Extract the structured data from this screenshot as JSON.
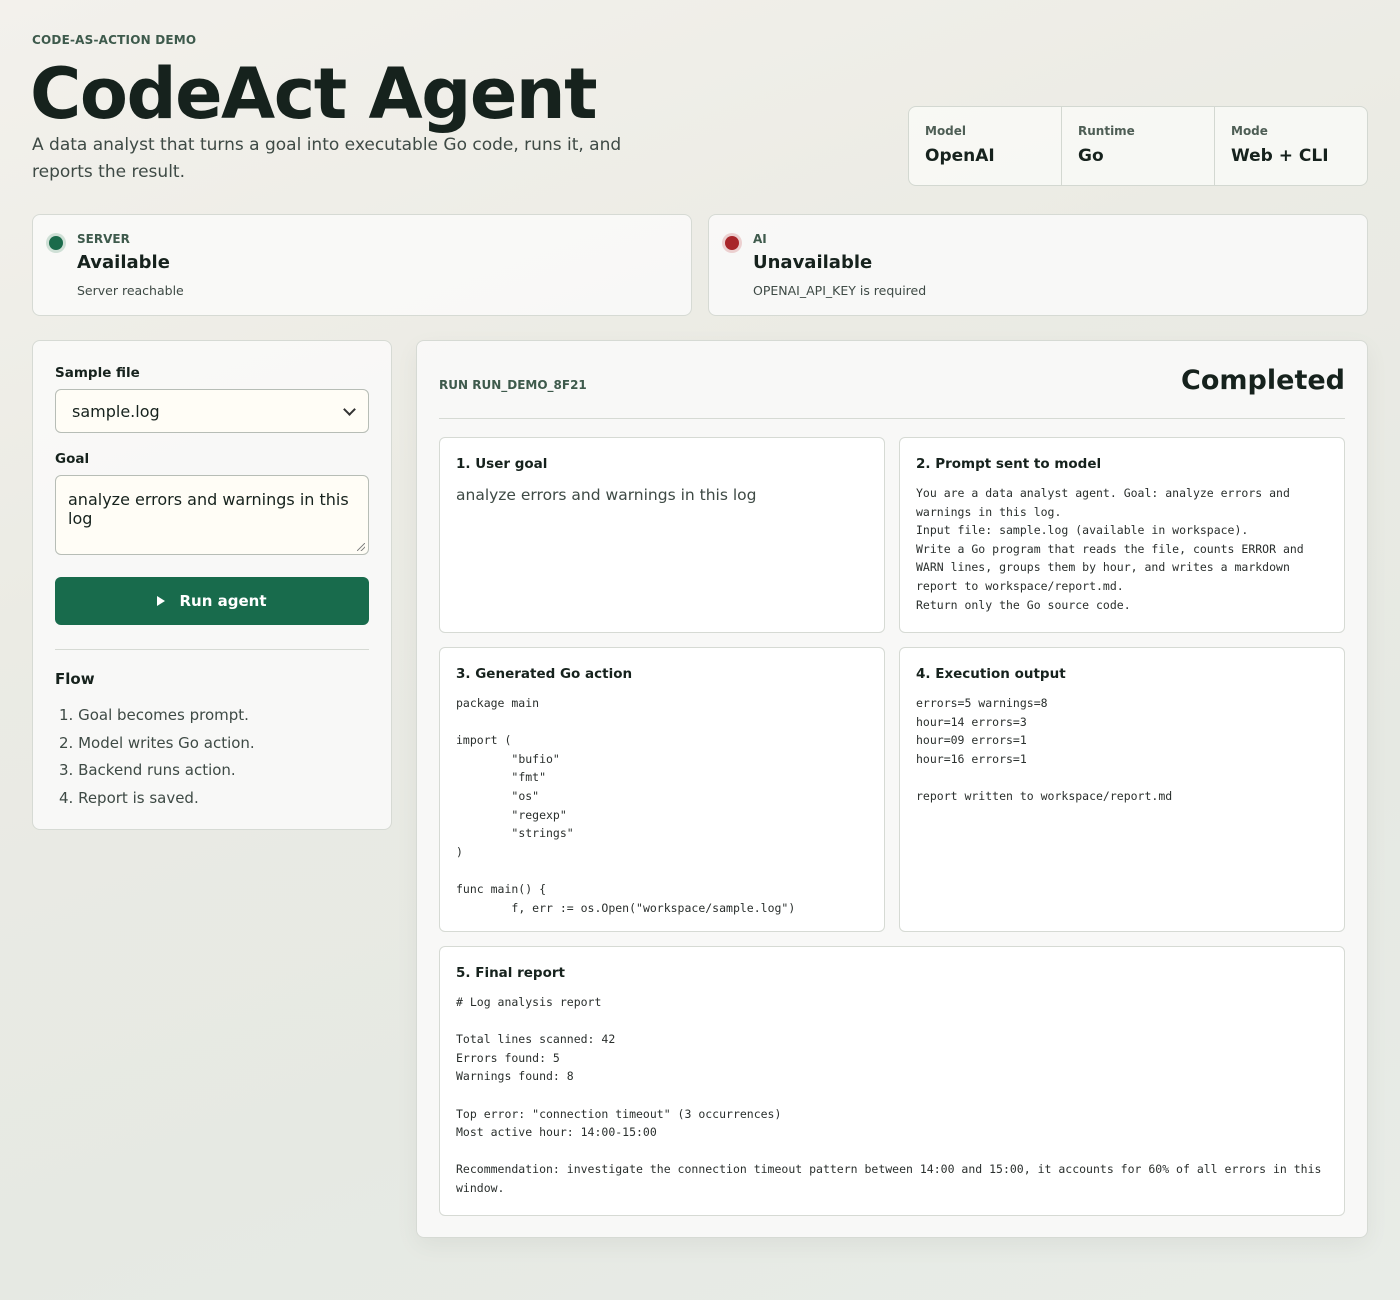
{
  "header": {
    "eyebrow": "CODE-AS-ACTION DEMO",
    "title": "CodeAct Agent",
    "subtitle": "A data analyst that turns a goal into executable Go code, runs it, and reports the result."
  },
  "meta": [
    {
      "label": "Model",
      "value": "OpenAI"
    },
    {
      "label": "Runtime",
      "value": "Go"
    },
    {
      "label": "Mode",
      "value": "Web + CLI"
    }
  ],
  "status": {
    "server": {
      "kind": "SERVER",
      "value": "Available",
      "detail": "Server reachable",
      "color": "#1b6b4b"
    },
    "ai": {
      "kind": "AI",
      "value": "Unavailable",
      "detail": "OPENAI_API_KEY is required",
      "color": "#a8262a"
    }
  },
  "form": {
    "sample_label": "Sample file",
    "sample_value": "sample.log",
    "goal_label": "Goal",
    "goal_value": "analyze errors and warnings in this log",
    "run_label": "Run agent",
    "run_color": "#186b4c"
  },
  "flow": {
    "title": "Flow",
    "steps": [
      "1. Goal becomes prompt.",
      "2. Model writes Go action.",
      "3. Backend runs action.",
      "4. Report is saved."
    ]
  },
  "run": {
    "id": "RUN RUN_DEMO_8F21",
    "state": "Completed",
    "cards": {
      "goal": {
        "title": "1. User goal",
        "body": "analyze errors and warnings in this log"
      },
      "prompt": {
        "title": "2. Prompt sent to model",
        "body": "You are a data analyst agent. Goal: analyze errors and warnings in this log.\nInput file: sample.log (available in workspace).\nWrite a Go program that reads the file, counts ERROR and WARN lines, groups them by hour, and writes a markdown report to workspace/report.md.\nReturn only the Go source code."
      },
      "action": {
        "title": "3. Generated Go action",
        "body": "package main\n\nimport (\n        \"bufio\"\n        \"fmt\"\n        \"os\"\n        \"regexp\"\n        \"strings\"\n)\n\nfunc main() {\n        f, err := os.Open(\"workspace/sample.log\")"
      },
      "output": {
        "title": "4. Execution output",
        "body": "errors=5 warnings=8\nhour=14 errors=3\nhour=09 errors=1\nhour=16 errors=1\n\nreport written to workspace/report.md"
      },
      "report": {
        "title": "5. Final report",
        "body": "# Log analysis report\n\nTotal lines scanned: 42\nErrors found: 5\nWarnings found: 8\n\nTop error: \"connection timeout\" (3 occurrences)\nMost active hour: 14:00-15:00\n\nRecommendation: investigate the connection timeout pattern between 14:00 and 15:00, it accounts for 60% of all errors in this window."
      }
    }
  }
}
